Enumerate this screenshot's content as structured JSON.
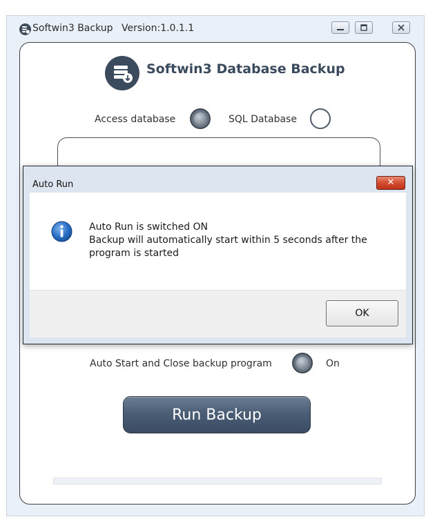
{
  "window": {
    "title": "Softwin3 Backup",
    "version": "Version:1.0.1.1"
  },
  "app": {
    "heading": "Softwin3 Database Backup",
    "access_db_label": "Access database",
    "access_db_selected": true,
    "sql_db_label": "SQL Database",
    "sql_db_selected": false,
    "auto_start_label": "Auto Start and Close backup program",
    "auto_start_state": "On",
    "run_button_label": "Run Backup"
  },
  "dialog": {
    "title": "Auto Run",
    "close_label": "✕",
    "message_lines": [
      "Auto Run is switched ON",
      "Backup will automatically start within 5 seconds after the",
      "program is started"
    ],
    "ok_label": "OK"
  },
  "colors": {
    "panel_accent": "#4b5e76",
    "close_red": "#d24c30",
    "info_blue": "#1d5fb6"
  },
  "icons": {
    "app": "database-backup-icon",
    "info": "info-icon"
  }
}
